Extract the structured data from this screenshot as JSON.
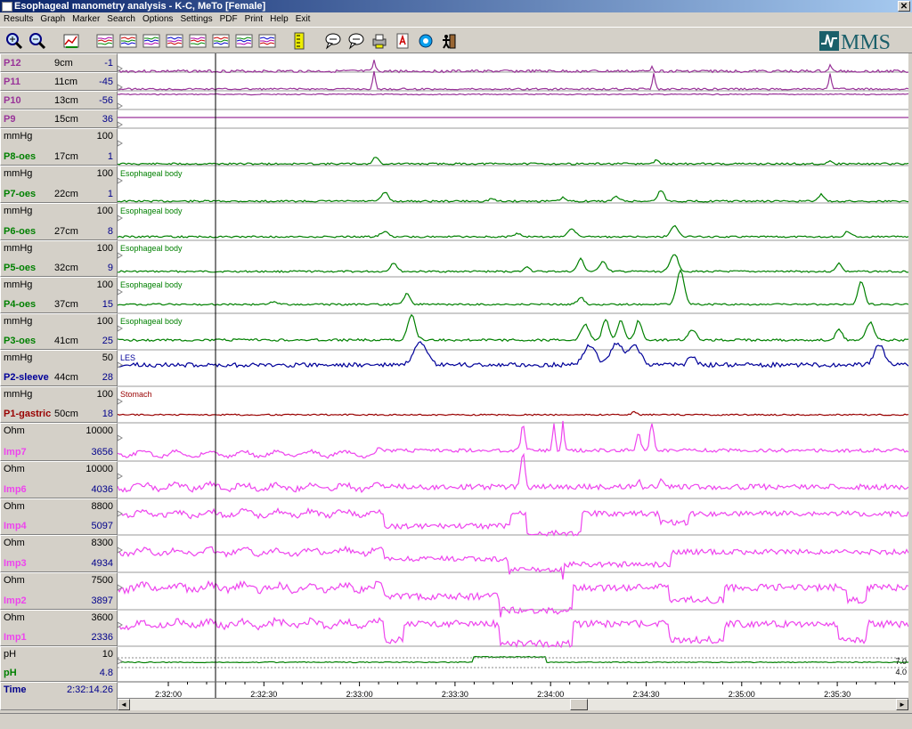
{
  "window": {
    "title": "Esophageal manometry analysis - K-C, MeTo [Female]",
    "close_glyph": "✕"
  },
  "menu": [
    "Results",
    "Graph",
    "Marker",
    "Search",
    "Options",
    "Settings",
    "PDF",
    "Print",
    "Help",
    "Exit"
  ],
  "toolbar_icons": [
    "zoom-in-icon",
    "zoom-out-icon",
    "edit-chart-icon",
    "graph-view-1-icon",
    "graph-view-2-icon",
    "graph-view-3-icon",
    "graph-view-4-icon",
    "graph-view-5-icon",
    "graph-view-6-icon",
    "graph-view-7-icon",
    "graph-view-8-icon",
    "ruler-icon",
    "comment-icon",
    "comment-add-icon",
    "print-icon",
    "pdf-icon",
    "help-icon",
    "exit-icon"
  ],
  "logo": {
    "text": "MMS"
  },
  "channels": [
    {
      "id": "p12",
      "name": "P12",
      "pos": "9cm",
      "unit": "",
      "max": "",
      "cur": "-1",
      "color": "#993399",
      "label": ""
    },
    {
      "id": "p11",
      "name": "P11",
      "pos": "11cm",
      "unit": "",
      "max": "",
      "cur": "-45",
      "color": "#993399",
      "label": ""
    },
    {
      "id": "p10",
      "name": "P10",
      "pos": "13cm",
      "unit": "",
      "max": "",
      "cur": "-56",
      "color": "#993399",
      "label": ""
    },
    {
      "id": "p9",
      "name": "P9",
      "pos": "15cm",
      "unit": "",
      "max": "",
      "cur": "36",
      "color": "#993399",
      "label": ""
    },
    {
      "id": "p8",
      "name": "P8-oes",
      "pos": "17cm",
      "unit": "mmHg",
      "max": "100",
      "cur": "1",
      "color": "#008000",
      "label": ""
    },
    {
      "id": "p7",
      "name": "P7-oes",
      "pos": "22cm",
      "unit": "mmHg",
      "max": "100",
      "cur": "1",
      "color": "#008000",
      "label": "Esophageal body"
    },
    {
      "id": "p6",
      "name": "P6-oes",
      "pos": "27cm",
      "unit": "mmHg",
      "max": "100",
      "cur": "8",
      "color": "#008000",
      "label": "Esophageal body"
    },
    {
      "id": "p5",
      "name": "P5-oes",
      "pos": "32cm",
      "unit": "mmHg",
      "max": "100",
      "cur": "9",
      "color": "#008000",
      "label": "Esophageal body"
    },
    {
      "id": "p4",
      "name": "P4-oes",
      "pos": "37cm",
      "unit": "mmHg",
      "max": "100",
      "cur": "15",
      "color": "#008000",
      "label": "Esophageal body"
    },
    {
      "id": "p3",
      "name": "P3-oes",
      "pos": "41cm",
      "unit": "mmHg",
      "max": "100",
      "cur": "25",
      "color": "#008000",
      "label": "Esophageal body"
    },
    {
      "id": "p2",
      "name": "P2-sleeve",
      "pos": "44cm",
      "unit": "mmHg",
      "max": "50",
      "cur": "28",
      "color": "#000099",
      "label": "LES"
    },
    {
      "id": "p1",
      "name": "P1-gastric",
      "pos": "50cm",
      "unit": "mmHg",
      "max": "100",
      "cur": "18",
      "color": "#990000",
      "label": "Stomach"
    },
    {
      "id": "imp7",
      "name": "Imp7",
      "pos": "",
      "unit": "Ohm",
      "max": "10000",
      "cur": "3656",
      "color": "#ee44ee",
      "label": ""
    },
    {
      "id": "imp6",
      "name": "Imp6",
      "pos": "",
      "unit": "Ohm",
      "max": "10000",
      "cur": "4036",
      "color": "#ee44ee",
      "label": ""
    },
    {
      "id": "imp4",
      "name": "Imp4",
      "pos": "",
      "unit": "Ohm",
      "max": "8800",
      "cur": "5097",
      "color": "#ee44ee",
      "label": ""
    },
    {
      "id": "imp3",
      "name": "Imp3",
      "pos": "",
      "unit": "Ohm",
      "max": "8300",
      "cur": "4934",
      "color": "#ee44ee",
      "label": ""
    },
    {
      "id": "imp2",
      "name": "Imp2",
      "pos": "",
      "unit": "Ohm",
      "max": "7500",
      "cur": "3897",
      "color": "#ee44ee",
      "label": ""
    },
    {
      "id": "imp1",
      "name": "Imp1",
      "pos": "",
      "unit": "Ohm",
      "max": "3600",
      "cur": "2336",
      "color": "#ee44ee",
      "label": ""
    },
    {
      "id": "ph",
      "name": "pH",
      "pos": "",
      "unit": "pH",
      "max": "10",
      "cur": "4.8",
      "color": "#008000",
      "label": ""
    }
  ],
  "time": {
    "label": "Time",
    "value": "2:32:14.26"
  },
  "ph_refs": [
    "7.0",
    "4.0"
  ],
  "time_ticks": [
    "2:32:00",
    "2:32:30",
    "2:33:00",
    "2:33:30",
    "2:34:00",
    "2:34:30",
    "2:35:00",
    "2:35:30"
  ],
  "scroll": {
    "left": "◄",
    "right": "►"
  }
}
